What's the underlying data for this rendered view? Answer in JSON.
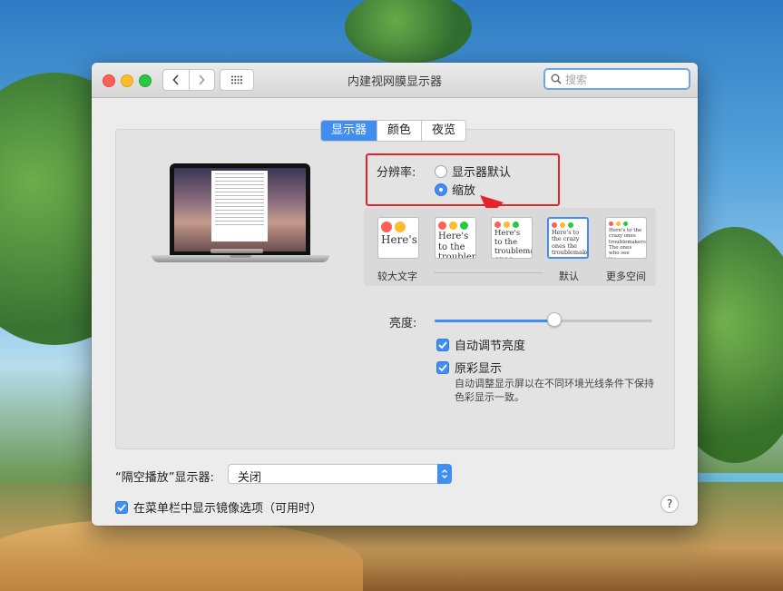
{
  "window": {
    "title": "内建视网膜显示器",
    "search_placeholder": "搜索"
  },
  "tabs": [
    {
      "label": "显示器",
      "active": true
    },
    {
      "label": "颜色",
      "active": false
    },
    {
      "label": "夜览",
      "active": false
    }
  ],
  "resolution": {
    "label": "分辨率:",
    "options": [
      {
        "label": "显示器默认",
        "selected": false
      },
      {
        "label": "缩放",
        "selected": true
      }
    ]
  },
  "scale": {
    "thumbnails": [
      {
        "text": "Here's",
        "selected": false
      },
      {
        "text": "Here's to the troublemakers",
        "selected": false
      },
      {
        "text": "Here's to the troublemakers, ones who see",
        "selected": false
      },
      {
        "text": "Here's to the crazy ones the troublemakers. The ones who see things",
        "selected": true
      },
      {
        "text": "Here's to the crazy ones troublemakers. The ones who see things can quote them, disagree rules. And they have the status quo. About the only thing",
        "selected": false
      }
    ],
    "labels": {
      "larger_text": "较大文字",
      "default": "默认",
      "more_space": "更多空间"
    }
  },
  "brightness": {
    "label": "亮度:",
    "level": 0.55
  },
  "checkboxes": {
    "auto_brightness": {
      "label": "自动调节亮度",
      "checked": true
    },
    "true_tone": {
      "label": "原彩显示",
      "checked": true,
      "description": "自动调整显示屏以在不同环境光线条件下保持色彩显示一致。"
    }
  },
  "airplay": {
    "label": "“隔空播放”显示器:",
    "value": "关闭"
  },
  "mirroring": {
    "label": "在菜单栏中显示镜像选项（可用时）",
    "checked": true
  },
  "help": {
    "label": "?"
  },
  "colors": {
    "accent": "#3f8ef0",
    "highlight_box": "#e5232b"
  }
}
